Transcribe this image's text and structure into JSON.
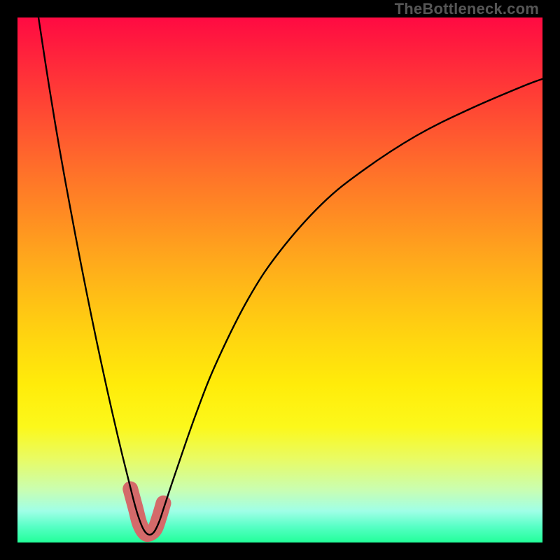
{
  "watermark": "TheBottleneck.com",
  "chart_data": {
    "type": "line",
    "title": "",
    "xlabel": "",
    "ylabel": "",
    "xlim": [
      0,
      100
    ],
    "ylim": [
      0,
      100
    ],
    "series": [
      {
        "name": "bottleneck-curve",
        "x": [
          4,
          6,
          8,
          10,
          12,
          14,
          16,
          18,
          20,
          22,
          23,
          24,
          25,
          26,
          27,
          28,
          30,
          34,
          38,
          44,
          50,
          58,
          66,
          76,
          86,
          96,
          100
        ],
        "y": [
          100,
          87,
          75,
          64,
          53.5,
          43.5,
          34,
          25,
          16.5,
          8.5,
          5,
          2.5,
          1.5,
          2,
          4,
          7,
          13,
          24.5,
          34.5,
          46.5,
          55.5,
          64.5,
          71,
          77.5,
          82.5,
          86.8,
          88.3
        ]
      },
      {
        "name": "highlight-near-zero",
        "x": [
          21.5,
          22.5,
          23.3,
          24.3,
          25.2,
          26.2,
          27.0,
          27.8
        ],
        "y": [
          10.2,
          6.5,
          3.5,
          1.8,
          1.7,
          2.6,
          4.8,
          7.5
        ]
      }
    ],
    "colors": {
      "curve": "#000000",
      "highlight": "#d46a6a",
      "gradient_top": "#ff0a42",
      "gradient_bottom": "#22ff99"
    }
  }
}
